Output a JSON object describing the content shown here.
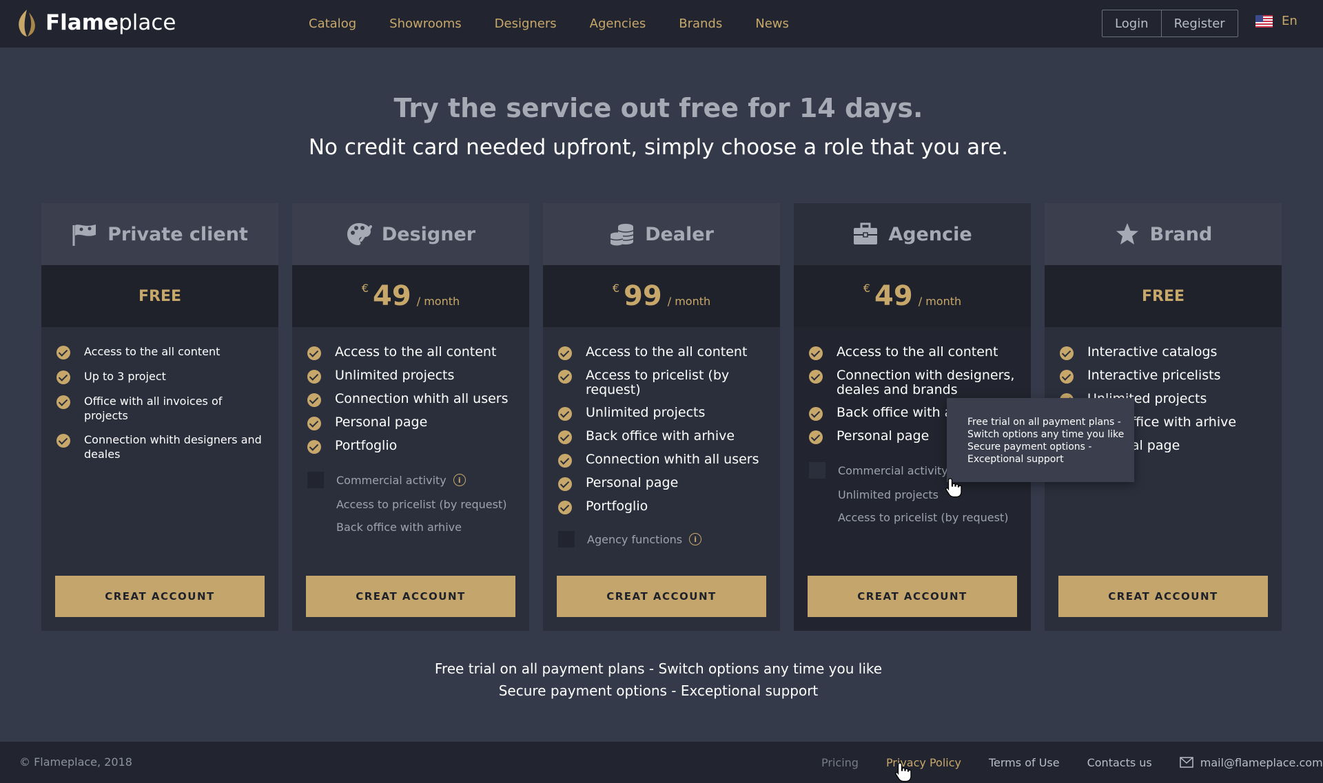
{
  "header": {
    "logo_bold": "Flame",
    "logo_rest": "place",
    "nav": [
      "Catalog",
      "Showrooms",
      "Designers",
      "Agencies",
      "Brands",
      "News"
    ],
    "login": "Login",
    "register": "Register",
    "language": "En"
  },
  "hero": {
    "title": "Try the service out free for 14 days.",
    "subtitle": "No credit card needed upfront, simply choose a role that you are."
  },
  "plans": [
    {
      "name": "Private client",
      "icon": "mask-icon",
      "price_text": "FREE",
      "features": [
        "Access to the all content",
        "Up to 3 project",
        "Office with all invoices of projects",
        "Connection whith designers and deales"
      ],
      "cta": "CREAT ACCOUNT"
    },
    {
      "name": "Designer",
      "icon": "palette-icon",
      "currency": "€",
      "price": "49",
      "period": "/ month",
      "features": [
        "Access to the all content",
        "Unlimited projects",
        "Connection whith all users",
        "Personal page",
        "Portfoglio"
      ],
      "inactive": [
        "Commercial activity",
        "Access to pricelist (by request)",
        "Back office with arhive"
      ],
      "cta": "CREAT ACCOUNT"
    },
    {
      "name": "Dealer",
      "icon": "coins-icon",
      "currency": "€",
      "price": "99",
      "period": "/ month",
      "features": [
        "Access to the all content",
        "Access to pricelist (by request)",
        "Unlimited projects",
        "Back office with arhive",
        "Connection whith all users",
        "Personal page",
        "Portfoglio"
      ],
      "inactive": [
        "Agency functions"
      ],
      "cta": "CREAT ACCOUNT"
    },
    {
      "name": "Agencie",
      "icon": "briefcase-icon",
      "currency": "€",
      "price": "49",
      "period": "/ month",
      "features": [
        "Access to the all content",
        "Connection with designers, deales and brands",
        "Back office with arhive",
        "Personal page"
      ],
      "inactive": [
        "Commercial activity",
        "Unlimited projects",
        "Access to pricelist (by request)"
      ],
      "cta": "CREAT ACCOUNT"
    },
    {
      "name": "Brand",
      "icon": "star-icon",
      "price_text": "FREE",
      "features": [
        "Interactive catalogs",
        "Interactive pricelists",
        "Unlimited projects",
        "Back office with arhive",
        "Personal page"
      ],
      "cta": "CREAT ACCOUNT"
    }
  ],
  "tooltip": [
    "Free trial on all payment plans  -",
    "Switch options any time you like",
    "Secure payment options  -",
    "Exceptional support"
  ],
  "perks": {
    "line1": "Free trial on all payment plans  -  Switch options any time you like",
    "line2": "Secure payment options  -  Exceptional support"
  },
  "footer": {
    "copyright": "© Flameplace, 2018",
    "links": [
      "Pricing",
      "Privacy Policy",
      "Terms of Use",
      "Contacts us"
    ],
    "email": "mail@flameplace.com"
  },
  "colors": {
    "background": "#353a4a",
    "header": "#22252f",
    "accent": "#c7a86a",
    "card": "#2b2f3c",
    "card_featured": "#22252f"
  }
}
